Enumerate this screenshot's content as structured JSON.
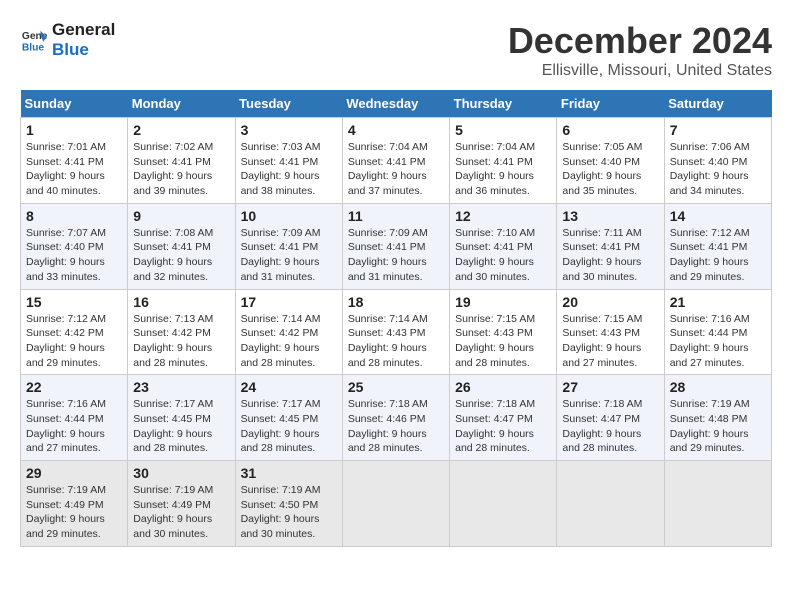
{
  "logo": {
    "line1": "General",
    "line2": "Blue"
  },
  "title": "December 2024",
  "subtitle": "Ellisville, Missouri, United States",
  "days_of_week": [
    "Sunday",
    "Monday",
    "Tuesday",
    "Wednesday",
    "Thursday",
    "Friday",
    "Saturday"
  ],
  "weeks": [
    [
      {
        "day": "1",
        "sunrise": "7:01 AM",
        "sunset": "4:41 PM",
        "daylight": "9 hours and 40 minutes."
      },
      {
        "day": "2",
        "sunrise": "7:02 AM",
        "sunset": "4:41 PM",
        "daylight": "9 hours and 39 minutes."
      },
      {
        "day": "3",
        "sunrise": "7:03 AM",
        "sunset": "4:41 PM",
        "daylight": "9 hours and 38 minutes."
      },
      {
        "day": "4",
        "sunrise": "7:04 AM",
        "sunset": "4:41 PM",
        "daylight": "9 hours and 37 minutes."
      },
      {
        "day": "5",
        "sunrise": "7:04 AM",
        "sunset": "4:41 PM",
        "daylight": "9 hours and 36 minutes."
      },
      {
        "day": "6",
        "sunrise": "7:05 AM",
        "sunset": "4:40 PM",
        "daylight": "9 hours and 35 minutes."
      },
      {
        "day": "7",
        "sunrise": "7:06 AM",
        "sunset": "4:40 PM",
        "daylight": "9 hours and 34 minutes."
      }
    ],
    [
      {
        "day": "8",
        "sunrise": "7:07 AM",
        "sunset": "4:40 PM",
        "daylight": "9 hours and 33 minutes."
      },
      {
        "day": "9",
        "sunrise": "7:08 AM",
        "sunset": "4:41 PM",
        "daylight": "9 hours and 32 minutes."
      },
      {
        "day": "10",
        "sunrise": "7:09 AM",
        "sunset": "4:41 PM",
        "daylight": "9 hours and 31 minutes."
      },
      {
        "day": "11",
        "sunrise": "7:09 AM",
        "sunset": "4:41 PM",
        "daylight": "9 hours and 31 minutes."
      },
      {
        "day": "12",
        "sunrise": "7:10 AM",
        "sunset": "4:41 PM",
        "daylight": "9 hours and 30 minutes."
      },
      {
        "day": "13",
        "sunrise": "7:11 AM",
        "sunset": "4:41 PM",
        "daylight": "9 hours and 30 minutes."
      },
      {
        "day": "14",
        "sunrise": "7:12 AM",
        "sunset": "4:41 PM",
        "daylight": "9 hours and 29 minutes."
      }
    ],
    [
      {
        "day": "15",
        "sunrise": "7:12 AM",
        "sunset": "4:42 PM",
        "daylight": "9 hours and 29 minutes."
      },
      {
        "day": "16",
        "sunrise": "7:13 AM",
        "sunset": "4:42 PM",
        "daylight": "9 hours and 28 minutes."
      },
      {
        "day": "17",
        "sunrise": "7:14 AM",
        "sunset": "4:42 PM",
        "daylight": "9 hours and 28 minutes."
      },
      {
        "day": "18",
        "sunrise": "7:14 AM",
        "sunset": "4:43 PM",
        "daylight": "9 hours and 28 minutes."
      },
      {
        "day": "19",
        "sunrise": "7:15 AM",
        "sunset": "4:43 PM",
        "daylight": "9 hours and 28 minutes."
      },
      {
        "day": "20",
        "sunrise": "7:15 AM",
        "sunset": "4:43 PM",
        "daylight": "9 hours and 27 minutes."
      },
      {
        "day": "21",
        "sunrise": "7:16 AM",
        "sunset": "4:44 PM",
        "daylight": "9 hours and 27 minutes."
      }
    ],
    [
      {
        "day": "22",
        "sunrise": "7:16 AM",
        "sunset": "4:44 PM",
        "daylight": "9 hours and 27 minutes."
      },
      {
        "day": "23",
        "sunrise": "7:17 AM",
        "sunset": "4:45 PM",
        "daylight": "9 hours and 28 minutes."
      },
      {
        "day": "24",
        "sunrise": "7:17 AM",
        "sunset": "4:45 PM",
        "daylight": "9 hours and 28 minutes."
      },
      {
        "day": "25",
        "sunrise": "7:18 AM",
        "sunset": "4:46 PM",
        "daylight": "9 hours and 28 minutes."
      },
      {
        "day": "26",
        "sunrise": "7:18 AM",
        "sunset": "4:47 PM",
        "daylight": "9 hours and 28 minutes."
      },
      {
        "day": "27",
        "sunrise": "7:18 AM",
        "sunset": "4:47 PM",
        "daylight": "9 hours and 28 minutes."
      },
      {
        "day": "28",
        "sunrise": "7:19 AM",
        "sunset": "4:48 PM",
        "daylight": "9 hours and 29 minutes."
      }
    ],
    [
      {
        "day": "29",
        "sunrise": "7:19 AM",
        "sunset": "4:49 PM",
        "daylight": "9 hours and 29 minutes."
      },
      {
        "day": "30",
        "sunrise": "7:19 AM",
        "sunset": "4:49 PM",
        "daylight": "9 hours and 30 minutes."
      },
      {
        "day": "31",
        "sunrise": "7:19 AM",
        "sunset": "4:50 PM",
        "daylight": "9 hours and 30 minutes."
      },
      null,
      null,
      null,
      null
    ]
  ]
}
